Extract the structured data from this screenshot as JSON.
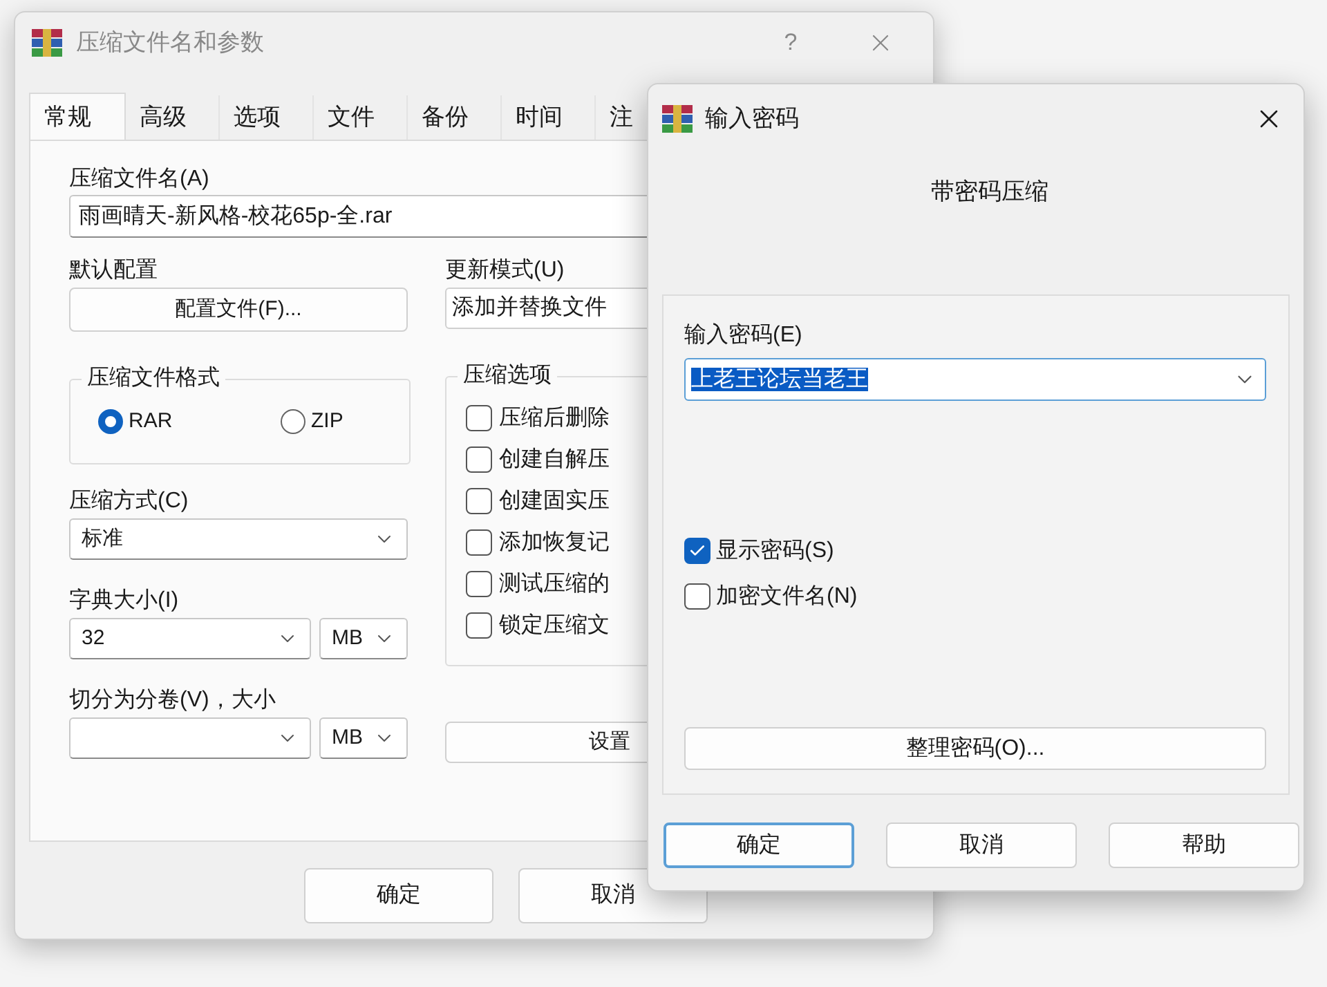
{
  "back_window": {
    "title": "压缩文件名和参数",
    "help_label": "?",
    "tabs": [
      {
        "label": "常规",
        "selected": true
      },
      {
        "label": "高级",
        "selected": false
      },
      {
        "label": "选项",
        "selected": false
      },
      {
        "label": "文件",
        "selected": false
      },
      {
        "label": "备份",
        "selected": false
      },
      {
        "label": "时间",
        "selected": false
      },
      {
        "label": "注",
        "selected": false
      }
    ],
    "archive_name": {
      "label": "压缩文件名(A)",
      "value": "雨画晴天-新风格-校花65p-全.rar"
    },
    "default_profile": {
      "label": "默认配置",
      "button": "配置文件(F)..."
    },
    "update_mode": {
      "label": "更新模式(U)",
      "value": "添加并替换文件"
    },
    "format": {
      "label": "压缩文件格式",
      "options": [
        {
          "label": "RAR",
          "selected": true
        },
        {
          "label": "ZIP",
          "selected": false
        }
      ]
    },
    "method": {
      "label": "压缩方式(C)",
      "value": "标准"
    },
    "dictionary": {
      "label": "字典大小(I)",
      "value": "32",
      "unit": "MB"
    },
    "split": {
      "label": "切分为分卷(V)，大小",
      "unit": "MB"
    },
    "options": {
      "label": "压缩选项",
      "items": [
        {
          "label": "压缩后删除",
          "checked": false
        },
        {
          "label": "创建自解压",
          "checked": false
        },
        {
          "label": "创建固实压",
          "checked": false
        },
        {
          "label": "添加恢复记",
          "checked": false
        },
        {
          "label": "测试压缩的",
          "checked": false
        },
        {
          "label": "锁定压缩文",
          "checked": false
        }
      ]
    },
    "settings_button": "设置",
    "buttons": [
      "确定",
      "取消"
    ]
  },
  "front_window": {
    "title": "输入密码",
    "heading": "带密码压缩",
    "password": {
      "label": "输入密码(E)",
      "value": "上老王论坛当老王",
      "selected": true
    },
    "checkboxes": [
      {
        "label": "显示密码(S)",
        "checked": true
      },
      {
        "label": "加密文件名(N)",
        "checked": false
      }
    ],
    "organize_button": "整理密码(O)...",
    "buttons": [
      {
        "label": "确定",
        "default": true
      },
      {
        "label": "取消",
        "default": false
      },
      {
        "label": "帮助",
        "default": false
      }
    ]
  }
}
